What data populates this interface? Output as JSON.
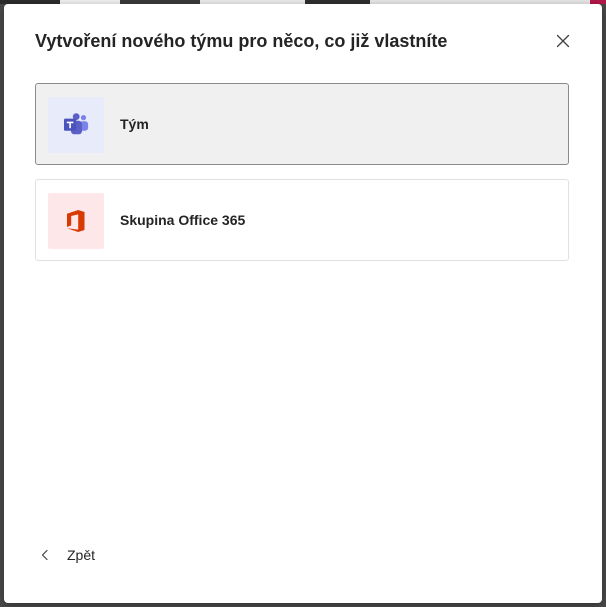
{
  "dialog": {
    "title": "Vytvoření nového týmu pro něco, co již vlastníte",
    "close_icon": "close-icon"
  },
  "options": [
    {
      "label": "Tým",
      "icon": "teams-icon",
      "tile_color": "#e8ebfa",
      "selected": true
    },
    {
      "label": "Skupina Office 365",
      "icon": "office-icon",
      "tile_color": "#fde7e9",
      "selected": false
    }
  ],
  "footer": {
    "back_label": "Zpět",
    "back_icon": "chevron-left-icon"
  },
  "colors": {
    "teams_brand": "#5b5fc7",
    "office_brand": "#d83b01",
    "text": "#242424"
  }
}
